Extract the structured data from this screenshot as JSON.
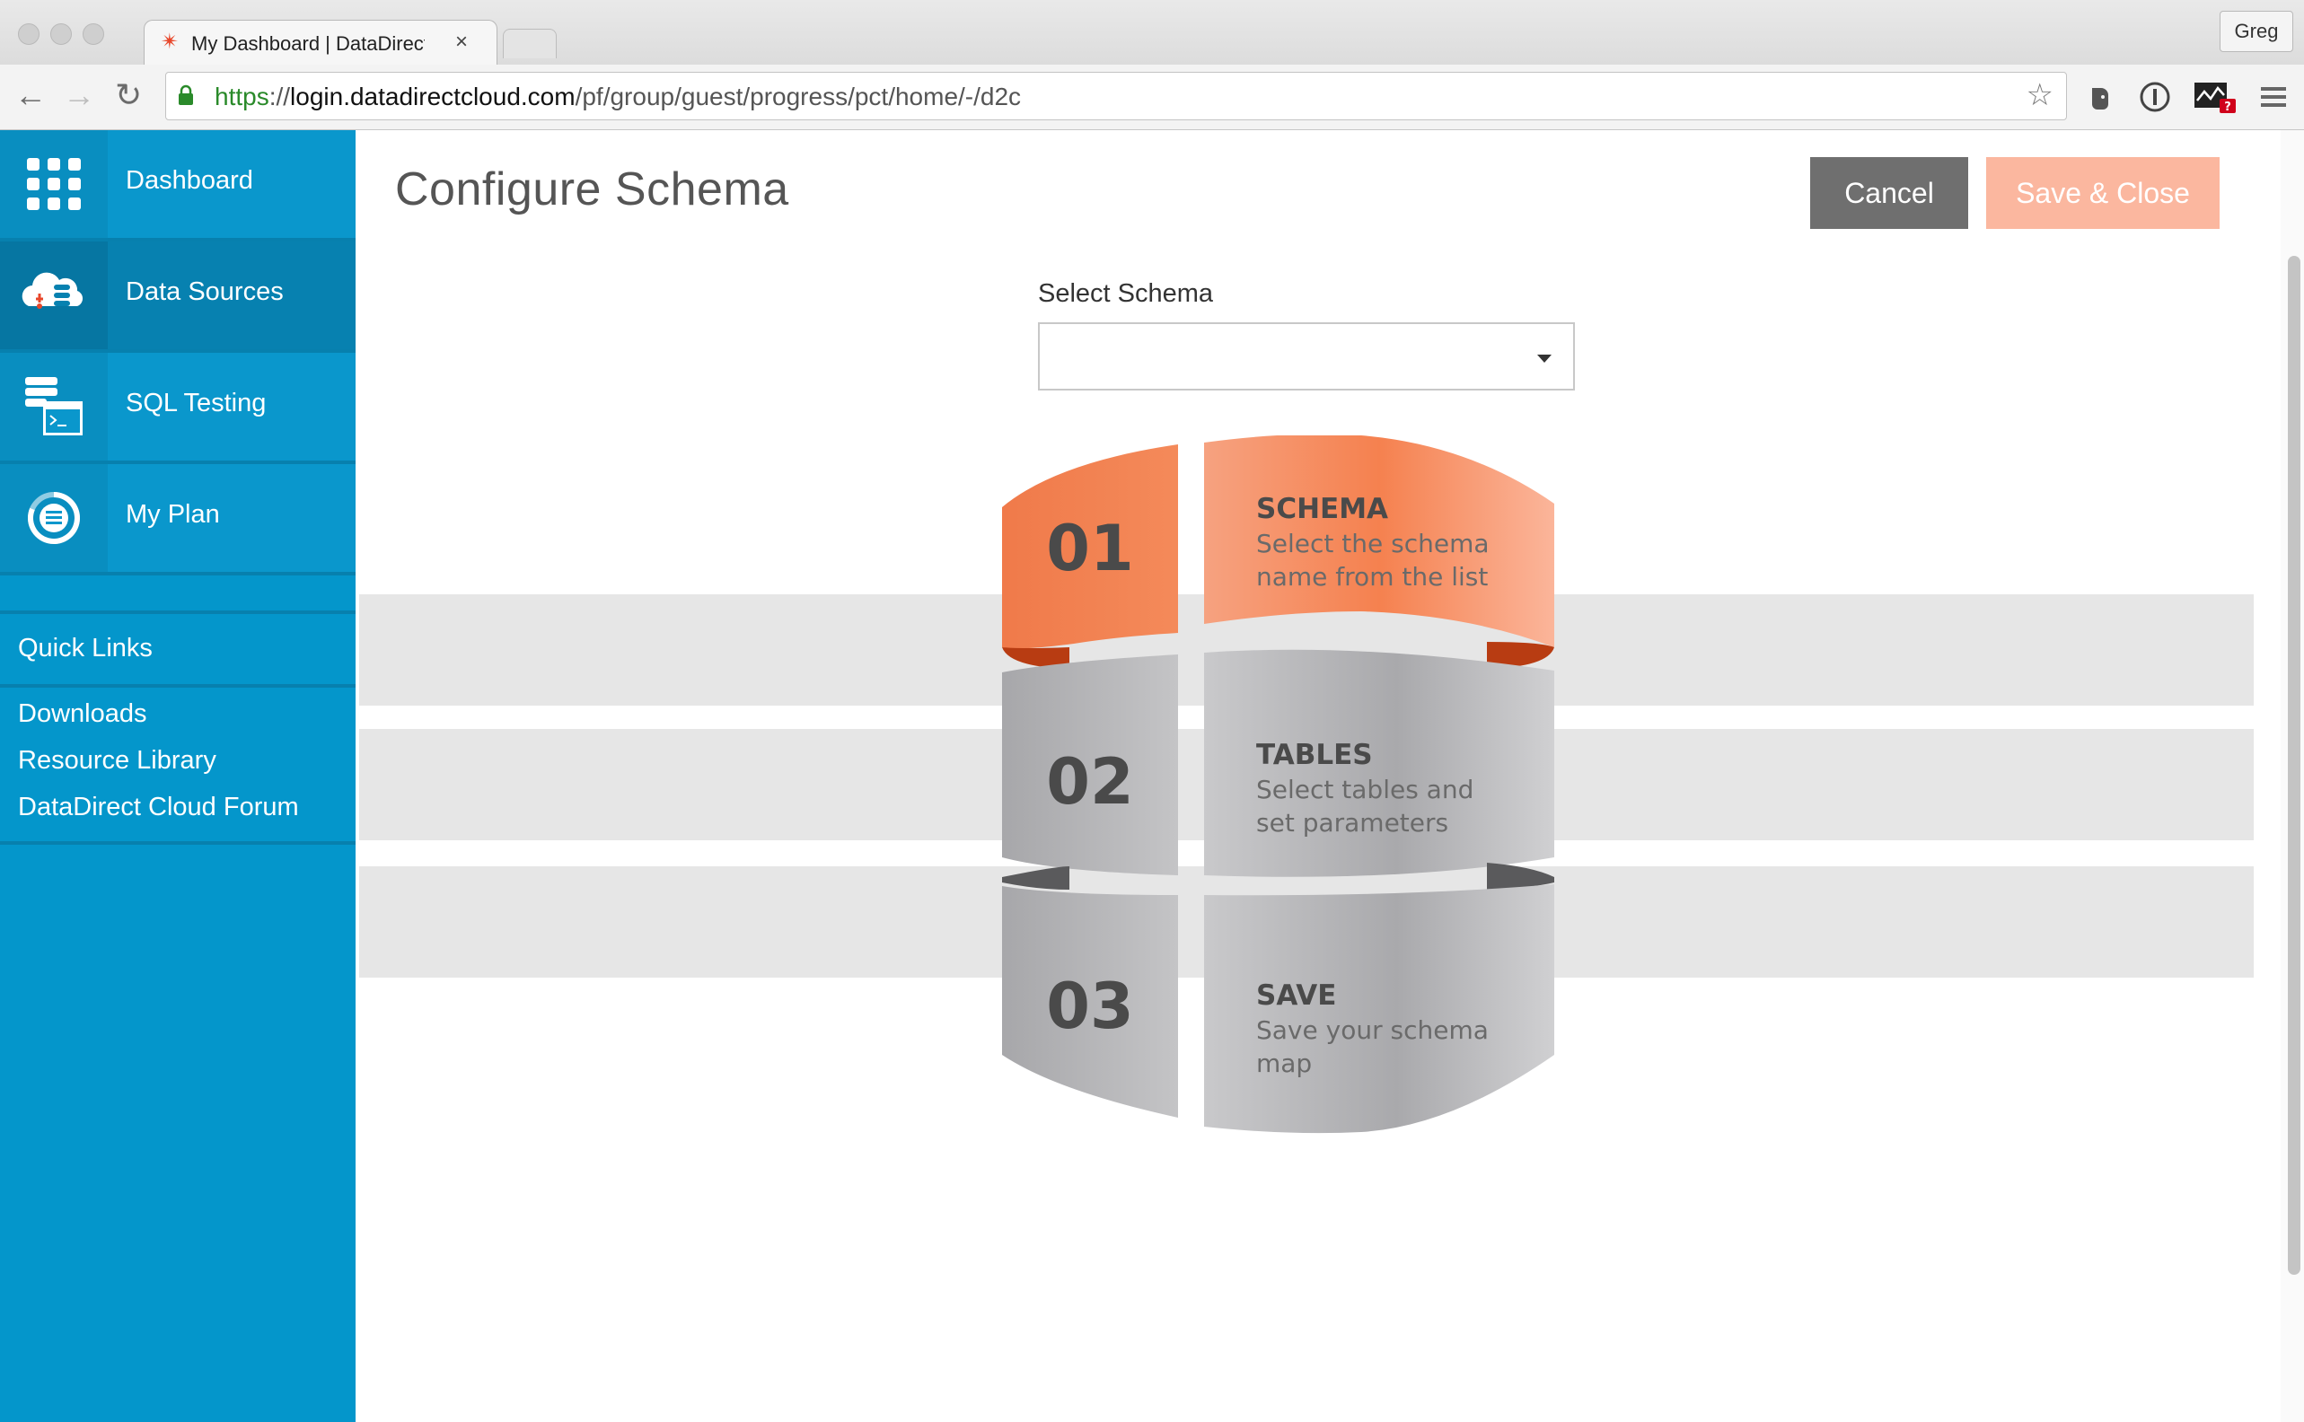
{
  "browser": {
    "tab_title": "My Dashboard | DataDirect Cloud",
    "tab_close": "×",
    "profile": "Greg",
    "url_scheme": "https",
    "url_sep": "://",
    "url_host": "login.datadirectcloud.com",
    "url_path": "/pf/group/guest/progress/pct/home/-/d2c"
  },
  "sidebar": {
    "items": [
      {
        "label": "Dashboard",
        "icon": "grid-icon"
      },
      {
        "label": "Data Sources",
        "icon": "cloud-database-icon"
      },
      {
        "label": "SQL Testing",
        "icon": "sql-terminal-icon"
      },
      {
        "label": "My Plan",
        "icon": "plan-gauge-icon"
      }
    ],
    "quick_links_heading": "Quick Links",
    "quick_links": [
      "Downloads",
      "Resource Library",
      "DataDirect Cloud Forum"
    ]
  },
  "main": {
    "title": "Configure Schema",
    "cancel_label": "Cancel",
    "save_close_label": "Save & Close",
    "select_label": "Select Schema",
    "select_value": ""
  },
  "steps": [
    {
      "number": "01",
      "title": "SCHEMA",
      "line1": "Select the schema",
      "line2": "name from the list",
      "color": "#f7895a"
    },
    {
      "number": "02",
      "title": "TABLES",
      "line1": "Select tables and",
      "line2": "set parameters",
      "color": "#b8b8bb"
    },
    {
      "number": "03",
      "title": "SAVE",
      "line1": "Save your schema",
      "line2": "map",
      "color": "#b8b8bb"
    }
  ],
  "colors": {
    "sidebar": "#0496cb",
    "cancel": "#6f6f6f",
    "save_close": "#fbb79f",
    "accent_orange": "#f7895a"
  }
}
